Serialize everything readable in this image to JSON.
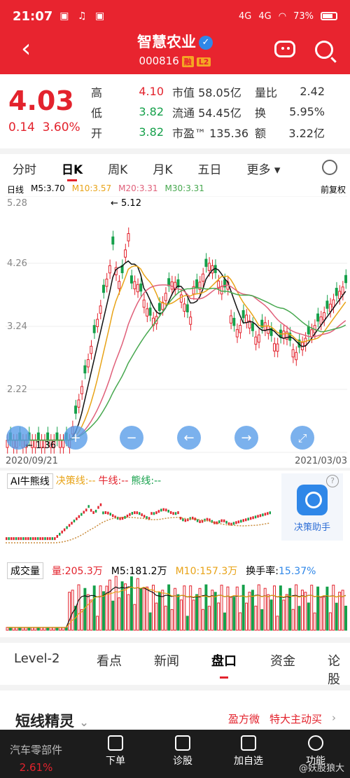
{
  "status": {
    "time": "21:07",
    "battery": "73%",
    "net1": "4G",
    "net2": "4G"
  },
  "header": {
    "name": "智慧农业",
    "code": "000816",
    "badge1": "融",
    "badge2": "L2",
    "verified": "✓"
  },
  "quote": {
    "price": "4.03",
    "change": "0.14",
    "change_pct": "3.60%",
    "rows": [
      {
        "l1": "高",
        "v1": "4.10",
        "m": "市值 58.05亿",
        "l2": "量比",
        "v2": "2.42"
      },
      {
        "l1": "低",
        "v1": "3.82",
        "m": "流通 54.45亿",
        "l2": "换",
        "v2": "5.95%"
      },
      {
        "l1": "开",
        "v1": "3.82",
        "m": "市盈™ 135.36",
        "l2": "额",
        "v2": "3.22亿"
      }
    ]
  },
  "tabs": [
    "分时",
    "日K",
    "周K",
    "月K",
    "五日",
    "更多 ▾"
  ],
  "legend": {
    "k": "日线",
    "ma5": "M5:3.70",
    "ma10": "M10:3.57",
    "ma20": "M20:3.31",
    "ma30": "M30:3.31",
    "adjust": "前复权"
  },
  "axis": {
    "y1": "5.28",
    "y2": "4.26",
    "y3": "3.24",
    "y4": "2.22",
    "high_mark": "← 5.12",
    "low_mark": "← 1.36",
    "date_start": "2020/09/21",
    "date_end": "2021/03/03"
  },
  "ai": {
    "title": "AI牛熊线",
    "l1": "决策线:--",
    "l2": "牛线:--",
    "l3": "熊线:--",
    "assistant": "决策助手",
    "help": "?"
  },
  "volume": {
    "select": "成交量",
    "v": "量:205.3万",
    "m5": "M5:181.2万",
    "m10": "M10:157.3万",
    "turn_label": "换手率:",
    "turn": "15.37%"
  },
  "bottom_tabs": [
    "Level-2",
    "看点",
    "新闻",
    "盘口",
    "资金",
    "论股"
  ],
  "spirit": {
    "title": "短线精灵",
    "chev": "⌄",
    "a": "盈方微",
    "b": "特大主动买",
    "arrow": "›"
  },
  "nav": {
    "sector": "汽车零部件",
    "sector_pct": "2.61%",
    "items": [
      "下单",
      "诊股",
      "加自选",
      "功能"
    ],
    "watermark": "@妖股狼大"
  },
  "colors": {
    "up": "#e3232d",
    "down": "#15a04a",
    "header": "#e8242f"
  }
}
